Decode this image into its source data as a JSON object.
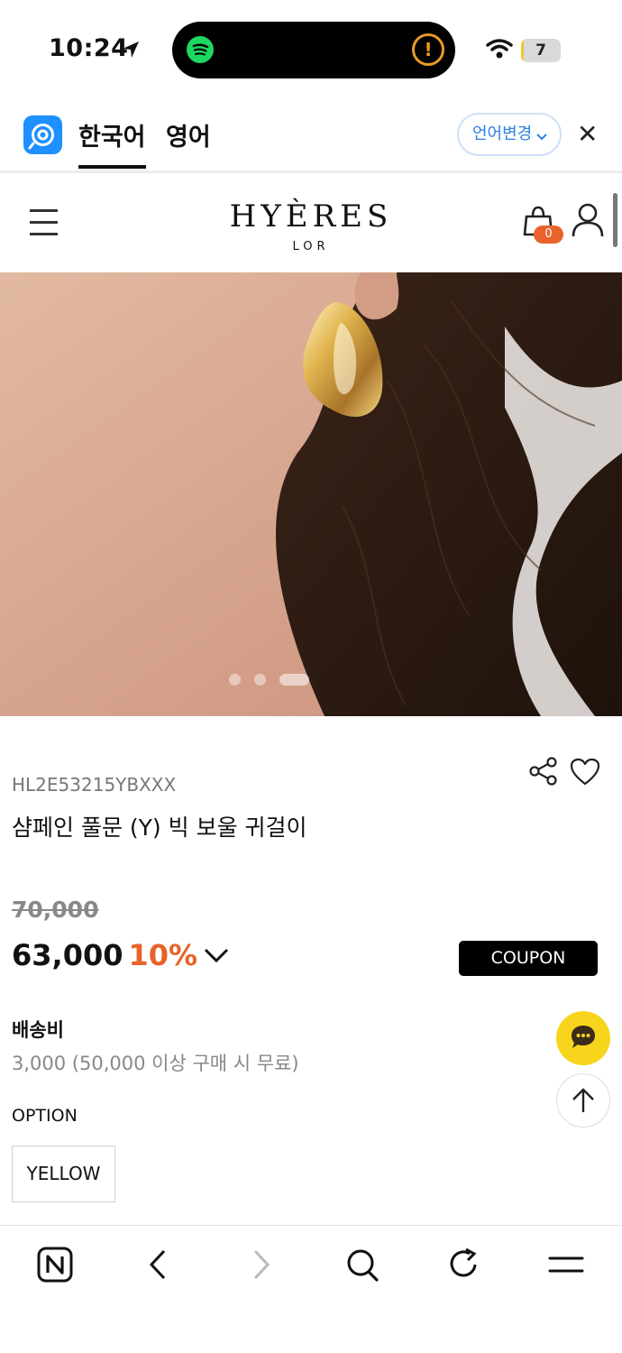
{
  "status_bar": {
    "time": "10:24",
    "battery": "7",
    "battery_level": 0.07
  },
  "translate_bar": {
    "active_lang": "한국어",
    "other_lang": "영어",
    "change_label": "언어변경",
    "close_symbol": "✕"
  },
  "header": {
    "brand": "HYÈRES",
    "brand_sub": "LOR",
    "cart_count": "0"
  },
  "carousel": {
    "slide_count": 3,
    "active_index": 2
  },
  "product": {
    "sku": "HL2E53215YBXXX",
    "name": "샴페인 풀문 (Y) 빅 보울 귀걸이",
    "original_price": "70,000",
    "sale_price": "63,000",
    "discount": "10%",
    "coupon_label": "COUPON",
    "shipping_label": "배송비",
    "shipping_value": "3,000 (50,000 이상 구매 시 무료)",
    "option_label": "OPTION",
    "option_value": "YELLOW"
  },
  "icons": {
    "share": "share-icon",
    "wishlist": "heart-icon",
    "chat": "chat-icon",
    "scroll_top": "arrow-up-icon"
  },
  "colors": {
    "accent_orange": "#e8632a",
    "coupon_bg": "#000000",
    "chat_yellow": "#f7d51c",
    "link_blue": "#2e7fe0"
  }
}
